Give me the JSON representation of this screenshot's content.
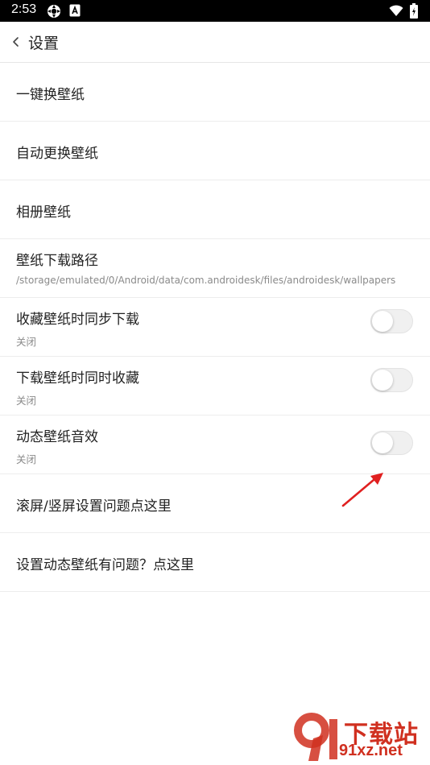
{
  "status_bar": {
    "time": "2:53"
  },
  "app_bar": {
    "title": "设置"
  },
  "settings": [
    {
      "label": "一键换壁纸"
    },
    {
      "label": "自动更换壁纸"
    },
    {
      "label": "相册壁纸"
    },
    {
      "label": "壁纸下载路径",
      "sub": "/storage/emulated/0/Android/data/com.androidesk/files/androidesk/wallpapers"
    },
    {
      "label": "收藏壁纸时同步下载",
      "sub": "关闭",
      "toggle": false
    },
    {
      "label": "下载壁纸时同时收藏",
      "sub": "关闭",
      "toggle": false
    },
    {
      "label": "动态壁纸音效",
      "sub": "关闭",
      "toggle": false
    },
    {
      "label": "滚屏/竖屏设置问题点这里"
    },
    {
      "label": "设置动态壁纸有问题？点这里"
    }
  ],
  "watermark": {
    "brand": "下载站",
    "url": "91xz.net"
  },
  "colors": {
    "annotation_arrow": "#e02020",
    "watermark": "#d03020"
  }
}
